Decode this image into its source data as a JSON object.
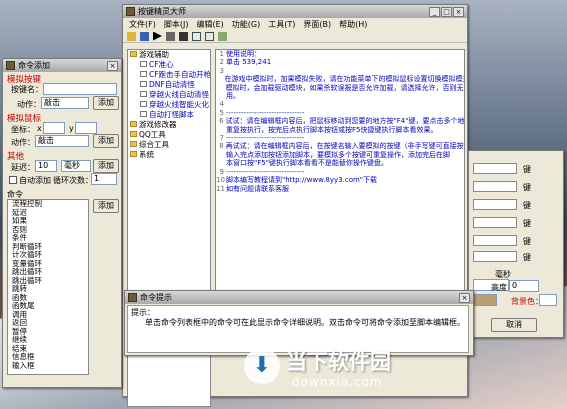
{
  "main": {
    "title": "按键精灵大师",
    "menus": [
      "文件(F)",
      "脚本(J)",
      "编辑(E)",
      "功能(G)",
      "工具(T)",
      "界面(B)",
      "帮助(H)"
    ],
    "tree": [
      [
        "游戏辅助",
        0
      ],
      [
        "CF准心",
        1
      ],
      [
        "CF跑击手自动开枪",
        1
      ],
      [
        "DNF自动清怪",
        1
      ],
      [
        "穿越火线自动清怪",
        1
      ],
      [
        "穿越火线智能火化",
        1
      ],
      [
        "自动打怪脚本",
        1
      ],
      [
        "游戏修改器",
        0
      ],
      [
        "QQ工具",
        0
      ],
      [
        "综合工具",
        0
      ],
      [
        "系统",
        0
      ]
    ],
    "lines": [
      {
        "n": "1",
        "t": "使用说明："
      },
      {
        "n": "2",
        "t": "单击 539,241"
      },
      {
        "n": "3",
        "t": ""
      },
      {
        "n": "",
        "t": "在游戏中模拟时，加果模拟失败，请在功能菜单下的模拟鼠标设置切换模拟模式，使用无法正确"
      },
      {
        "n": "",
        "t": "模拟时，会加载驱动模块，如果杀软误报是否允许加载，请选择允许，否则无法使"
      },
      {
        "n": "",
        "t": "用。"
      },
      {
        "n": "4",
        "t": ""
      },
      {
        "n": "5",
        "t": "-------------------------------"
      },
      {
        "n": "6",
        "t": "试试：请在编辑框内容后，把鼠标移动到您要的地方按\"F4\"键，要点击多个地方，"
      },
      {
        "n": "",
        "t": "重复按执行，按完后点执行脚本按钮或按F5快捷键执行脚本看效果。"
      },
      {
        "n": "7",
        "t": "-------------------------------"
      },
      {
        "n": "8",
        "t": "再试试：请在编辑框内容后，在按键名输入要模拟的按键（非手写键可直接按），"
      },
      {
        "n": "",
        "t": "输入完点添加按钮添加脚本，要模拟多个按键可重复操作，添加完后在脚"
      },
      {
        "n": "",
        "t": "本窗口按\"F5\"键执行脚本看看不是能替你操作键盘。"
      },
      {
        "n": "9",
        "t": "-------------------------------"
      },
      {
        "n": "10",
        "t": "脚本编写教程请到\"http://www.8yy3.com\"下载"
      },
      {
        "n": "11",
        "t": "如有问题请联系客服"
      }
    ]
  },
  "left": {
    "title": "命令添加",
    "g1": "模拟按键",
    "key_label": "按键名：",
    "key_val": "",
    "act_label": "动作：",
    "act_val": "敲击",
    "add": "添加",
    "g2": "模拟鼠标",
    "coord_label": "坐标：",
    "x": "x",
    "y": "y",
    "g3": "其他",
    "delay_label": "延迟：",
    "delay_val": "10",
    "unit": "毫秒",
    "auto_add": "自动添加",
    "loop_label": "循环次数：",
    "loop_val": "1",
    "cmd_title": "命令",
    "cmds": [
      "流程控制",
      "延迟",
      "如果",
      "否则",
      "条件",
      "判断循环",
      "计次循环",
      "变量循环",
      "跳出循环",
      "跳出循环",
      "跳转",
      "函数",
      "函数尾",
      "调用",
      "返回",
      "暂停",
      "继续",
      "结束",
      "信息框",
      "输入框"
    ]
  },
  "hint": {
    "title": "命令提示",
    "label": "提示：",
    "text": "单击命令列表框中的命令可在此显示命令详细说明。双击命令可将命令添加至脚本编辑框。"
  },
  "right": {
    "key": "键",
    "ms": "毫秒",
    "height": "高度",
    "h_val": "0",
    "fg": "背景色：",
    "cancel": "取消"
  },
  "wm": {
    "cn": "当下软件园",
    "en": "downxia.com"
  }
}
